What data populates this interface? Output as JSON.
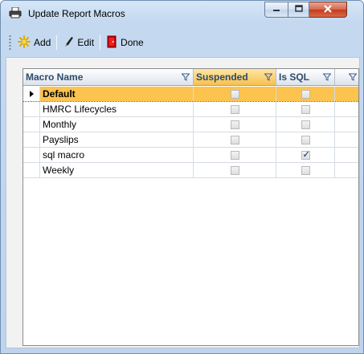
{
  "window": {
    "title": "Update Report Macros"
  },
  "toolbar": {
    "add_label": "Add",
    "edit_label": "Edit",
    "done_label": "Done"
  },
  "grid": {
    "columns": [
      {
        "label": "Macro Name"
      },
      {
        "label": "Suspended"
      },
      {
        "label": "Is SQL"
      },
      {
        "label": ""
      }
    ],
    "rows": [
      {
        "name": "Default",
        "suspended": false,
        "is_sql": false,
        "selected": true
      },
      {
        "name": "HMRC Lifecycles",
        "suspended": false,
        "is_sql": false,
        "selected": false
      },
      {
        "name": "Monthly",
        "suspended": false,
        "is_sql": false,
        "selected": false
      },
      {
        "name": "Payslips",
        "suspended": false,
        "is_sql": false,
        "selected": false
      },
      {
        "name": "sql macro",
        "suspended": false,
        "is_sql": true,
        "selected": false
      },
      {
        "name": "Weekly",
        "suspended": false,
        "is_sql": false,
        "selected": false
      }
    ]
  },
  "colors": {
    "selection": "#fcc34e",
    "header_text": "#2d4a6b",
    "close_button": "#c23b1d"
  }
}
